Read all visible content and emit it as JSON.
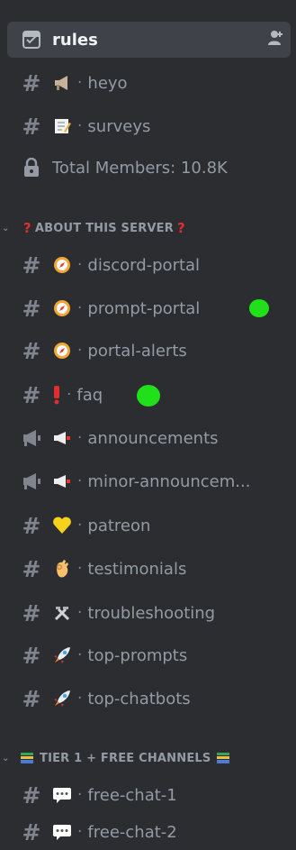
{
  "channels_top": [
    {
      "id": "rules",
      "icon": "rules-icon",
      "label": "rules",
      "active": true
    },
    {
      "id": "heyo",
      "icon": "hash-icon",
      "emoji": "megaphone-icon",
      "sep": "·",
      "label": "heyo"
    },
    {
      "id": "surveys",
      "icon": "hash-icon",
      "emoji": "memo-icon",
      "sep": "·",
      "label": "surveys"
    },
    {
      "id": "total-members",
      "icon": "lock-icon",
      "label": "Total Members: 10.8K"
    }
  ],
  "category_about": {
    "label": "ABOUT THIS SERVER",
    "prefix": "?",
    "suffix": "?"
  },
  "about_channels": [
    {
      "id": "discord-portal",
      "icon": "hash-icon",
      "emoji": "compass-icon",
      "sep": "·",
      "label": "discord-portal"
    },
    {
      "id": "prompt-portal",
      "icon": "hash-icon",
      "emoji": "compass-icon",
      "sep": "·",
      "label": "prompt-portal"
    },
    {
      "id": "portal-alerts",
      "icon": "hash-icon",
      "emoji": "compass-icon",
      "sep": "·",
      "label": "portal-alerts"
    },
    {
      "id": "faq",
      "icon": "hash-icon",
      "emoji": "exclamation-icon",
      "sep": "·",
      "label": "faq"
    },
    {
      "id": "announcements",
      "icon": "announcement-icon",
      "emoji": "loudspeaker-icon",
      "sep": "·",
      "label": "announcements"
    },
    {
      "id": "minor-announcements",
      "icon": "announcement-icon",
      "emoji": "loudspeaker-icon",
      "sep": "·",
      "label": "minor-announcem..."
    },
    {
      "id": "patreon",
      "icon": "hash-icon",
      "emoji": "heart-icon",
      "sep": "·",
      "label": "patreon"
    },
    {
      "id": "testimonials",
      "icon": "hash-icon",
      "emoji": "ok-hand-icon",
      "sep": "·",
      "label": "testimonials"
    },
    {
      "id": "troubleshooting",
      "icon": "hash-icon",
      "emoji": "tools-icon",
      "sep": "·",
      "label": "troubleshooting"
    },
    {
      "id": "top-prompts",
      "icon": "hash-icon",
      "emoji": "rocket-icon",
      "sep": "·",
      "label": "top-prompts"
    },
    {
      "id": "top-chatbots",
      "icon": "hash-icon",
      "emoji": "rocket-icon",
      "sep": "·",
      "label": "top-chatbots"
    }
  ],
  "category_tier": {
    "label": "TIER 1 + FREE CHANNELS"
  },
  "tier_channels": [
    {
      "id": "free-chat-1",
      "icon": "hash-icon",
      "emoji": "speech-balloon-icon",
      "sep": "·",
      "label": "free-chat-1"
    },
    {
      "id": "free-chat-2",
      "icon": "hash-icon",
      "emoji": "speech-balloon-icon",
      "sep": "·",
      "label": "free-chat-2"
    }
  ],
  "colors": {
    "background": "#2b2d31",
    "active": "#404249",
    "text": "#949ba4",
    "red": "#e02e2e",
    "green_mark": "#1fe01a"
  }
}
